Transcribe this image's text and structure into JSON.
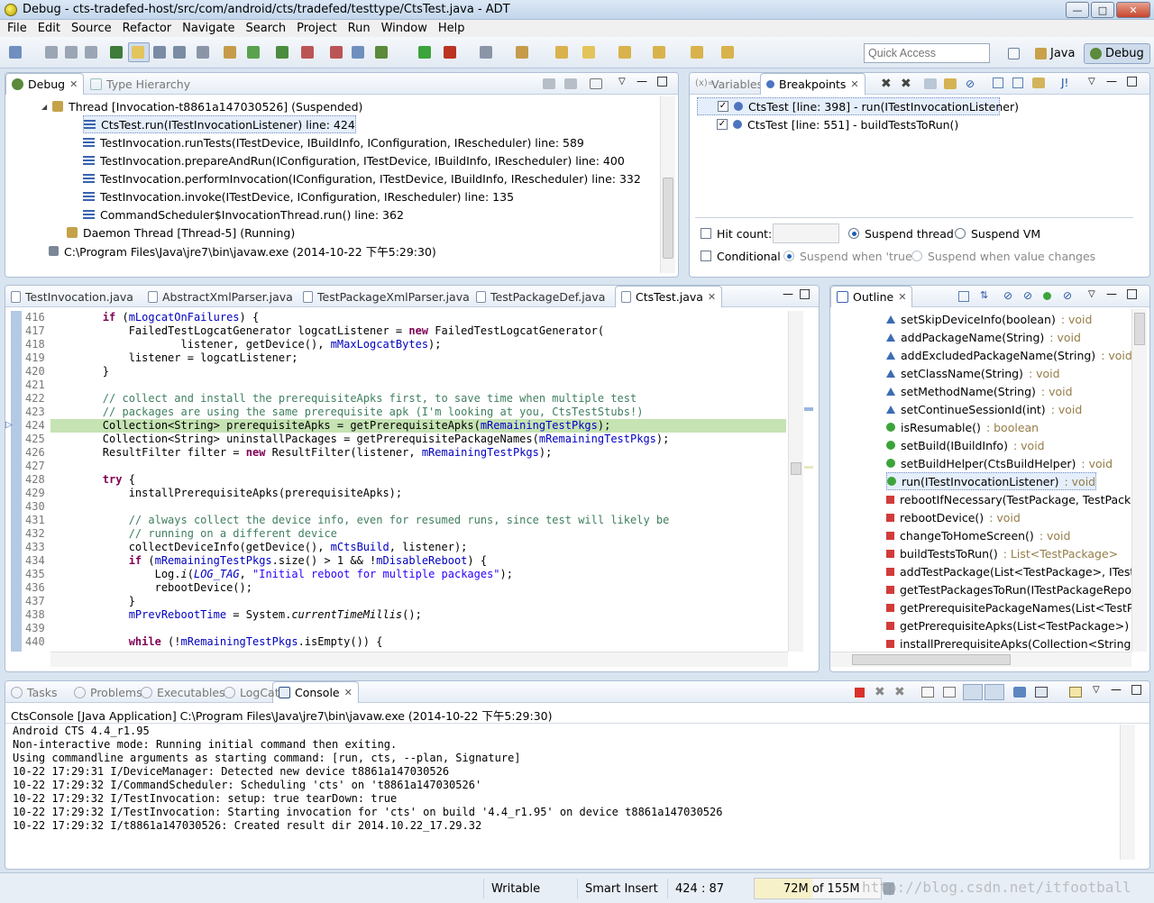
{
  "window": {
    "title": "Debug - cts-tradefed-host/src/com/android/cts/tradefed/testtype/CtsTest.java - ADT"
  },
  "menu": [
    "File",
    "Edit",
    "Source",
    "Refactor",
    "Navigate",
    "Search",
    "Project",
    "Run",
    "Window",
    "Help"
  ],
  "toolbar": {
    "quick_access_placeholder": "Quick Access",
    "perspectives": [
      "Java",
      "Debug"
    ]
  },
  "debug_view": {
    "tabs": [
      "Debug",
      "Type Hierarchy"
    ],
    "rows": [
      {
        "label": "Thread [Invocation-t8861a147030526] (Suspended)",
        "indent": 60,
        "kind": "thread"
      },
      {
        "label": "CtsTest.run(ITestInvocationListener) line: 424",
        "indent": 92,
        "kind": "frame",
        "selected": true
      },
      {
        "label": "TestInvocation.runTests(ITestDevice, IBuildInfo, IConfiguration, IRescheduler) line: 589",
        "indent": 92,
        "kind": "frame"
      },
      {
        "label": "TestInvocation.prepareAndRun(IConfiguration, ITestDevice, IBuildInfo, IRescheduler) line: 400",
        "indent": 92,
        "kind": "frame"
      },
      {
        "label": "TestInvocation.performInvocation(IConfiguration, ITestDevice, IBuildInfo, IRescheduler) line: 332",
        "indent": 92,
        "kind": "frame"
      },
      {
        "label": "TestInvocation.invoke(ITestDevice, IConfiguration, IRescheduler) line: 135",
        "indent": 92,
        "kind": "frame"
      },
      {
        "label": "CommandScheduler$InvocationThread.run() line: 362",
        "indent": 92,
        "kind": "frame"
      },
      {
        "label": "Daemon Thread [Thread-5] (Running)",
        "indent": 74,
        "kind": "thread"
      },
      {
        "label": "C:\\Program Files\\Java\\jre7\\bin\\javaw.exe (2014-10-22 下午5:29:30)",
        "indent": 54,
        "kind": "process"
      }
    ]
  },
  "breakpoints_view": {
    "tabs": [
      "Variables",
      "Breakpoints"
    ],
    "items": [
      "CtsTest [line: 398] - run(ITestInvocationListener)",
      "CtsTest [line: 551] - buildTestsToRun()"
    ],
    "hit_count_label": "Hit count:",
    "suspend_thread": "Suspend thread",
    "suspend_vm": "Suspend VM",
    "conditional_label": "Conditional",
    "suspend_true": "Suspend when 'true'",
    "suspend_changes": "Suspend when value changes"
  },
  "editor": {
    "tabs": [
      "TestInvocation.java",
      "AbstractXmlParser.java",
      "TestPackageXmlParser.java",
      "TestPackageDef.java",
      "CtsTest.java"
    ],
    "lines": [
      {
        "n": "416",
        "h": "        <span class=\"kw\">if</span> (<span class=\"fd\">mLogcatOnFailures</span>) {"
      },
      {
        "n": "417",
        "h": "            FailedTestLogcatGenerator logcatListener = <span class=\"kw\">new</span> FailedTestLogcatGenerator("
      },
      {
        "n": "418",
        "h": "                    listener, getDevice(), <span class=\"fd\">mMaxLogcatBytes</span>);"
      },
      {
        "n": "419",
        "h": "            listener = logcatListener;"
      },
      {
        "n": "420",
        "h": "        }"
      },
      {
        "n": "421",
        "h": ""
      },
      {
        "n": "422",
        "h": "        <span class=\"cm\">// collect and install the prerequisiteApks first, to save time when multiple test</span>"
      },
      {
        "n": "423",
        "h": "        <span class=\"cm\">// packages are using the same prerequisite apk (I'm looking at you, CtsTestStubs!)</span>"
      },
      {
        "n": "424",
        "h": "        Collection&lt;String&gt; prerequisiteApks = getPrerequisiteApks(<span class=\"fd\">mRemainingTestPkgs</span>);",
        "current": true
      },
      {
        "n": "425",
        "h": "        Collection&lt;String&gt; uninstallPackages = getPrerequisitePackageNames(<span class=\"fd\">mRemainingTestPkgs</span>);"
      },
      {
        "n": "426",
        "h": "        ResultFilter filter = <span class=\"kw\">new</span> ResultFilter(listener, <span class=\"fd\">mRemainingTestPkgs</span>);"
      },
      {
        "n": "427",
        "h": ""
      },
      {
        "n": "428",
        "h": "        <span class=\"kw\">try</span> {"
      },
      {
        "n": "429",
        "h": "            installPrerequisiteApks(prerequisiteApks);"
      },
      {
        "n": "430",
        "h": ""
      },
      {
        "n": "431",
        "h": "            <span class=\"cm\">// always collect the device info, even for resumed runs, since test will likely be</span>"
      },
      {
        "n": "432",
        "h": "            <span class=\"cm\">// running on a different device</span>"
      },
      {
        "n": "433",
        "h": "            collectDeviceInfo(getDevice(), <span class=\"fd\">mCtsBuild</span>, listener);"
      },
      {
        "n": "434",
        "h": "            <span class=\"kw\">if</span> (<span class=\"fd\">mRemainingTestPkgs</span>.size() &gt; 1 &amp;&amp; !<span class=\"fd\">mDisableReboot</span>) {"
      },
      {
        "n": "435",
        "h": "                Log.<span class=\"it\">i</span>(<span class=\"fd it\">LOG_TAG</span>, <span class=\"st\">\"Initial reboot for multiple packages\"</span>);"
      },
      {
        "n": "436",
        "h": "                rebootDevice();"
      },
      {
        "n": "437",
        "h": "            }"
      },
      {
        "n": "438",
        "h": "            <span class=\"fd\">mPrevRebootTime</span> = System.<span class=\"it\">currentTimeMillis</span>();"
      },
      {
        "n": "439",
        "h": ""
      },
      {
        "n": "440",
        "h": "            <span class=\"kw\">while</span> (!<span class=\"fd\">mRemainingTestPkgs</span>.isEmpty()) {"
      }
    ]
  },
  "outline": {
    "tab": "Outline",
    "items": [
      {
        "name": "setSkipDeviceInfo(boolean)",
        "ret": " : void",
        "icon": "tri"
      },
      {
        "name": "addPackageName(String)",
        "ret": " : void",
        "icon": "tri"
      },
      {
        "name": "addExcludedPackageName(String)",
        "ret": " : void",
        "icon": "tri"
      },
      {
        "name": "setClassName(String)",
        "ret": " : void",
        "icon": "tri"
      },
      {
        "name": "setMethodName(String)",
        "ret": " : void",
        "icon": "tri"
      },
      {
        "name": "setContinueSessionId(int)",
        "ret": " : void",
        "icon": "tri"
      },
      {
        "name": "isResumable()",
        "ret": " : boolean",
        "icon": "circ"
      },
      {
        "name": "setBuild(IBuildInfo)",
        "ret": " : void",
        "icon": "circ"
      },
      {
        "name": "setBuildHelper(CtsBuildHelper)",
        "ret": " : void",
        "icon": "circ"
      },
      {
        "name": "run(ITestInvocationListener)",
        "ret": " : void",
        "icon": "circ",
        "selected": true
      },
      {
        "name": "rebootIfNecessary(TestPackage, TestPack",
        "ret": "",
        "icon": "sq"
      },
      {
        "name": "rebootDevice()",
        "ret": " : void",
        "icon": "sq"
      },
      {
        "name": "changeToHomeScreen()",
        "ret": " : void",
        "icon": "sq"
      },
      {
        "name": "buildTestsToRun()",
        "ret": " : List<TestPackage>",
        "icon": "sq"
      },
      {
        "name": "addTestPackage(List<TestPackage>, ITest",
        "ret": "",
        "icon": "sq"
      },
      {
        "name": "getTestPackagesToRun(ITestPackageRepo",
        "ret": "",
        "icon": "sq"
      },
      {
        "name": "getPrerequisitePackageNames(List<TestPa",
        "ret": "",
        "icon": "sq"
      },
      {
        "name": "getPrerequisiteApks(List<TestPackage>) :",
        "ret": "",
        "icon": "sq"
      },
      {
        "name": "installPrerequisiteApks(Collection<String>",
        "ret": "",
        "icon": "sq"
      }
    ]
  },
  "console": {
    "tabs": [
      "Tasks",
      "Problems",
      "Executables",
      "LogCat",
      "Console"
    ],
    "header": "CtsConsole [Java Application] C:\\Program Files\\Java\\jre7\\bin\\javaw.exe (2014-10-22 下午5:29:30)",
    "lines": [
      "Android CTS 4.4_r1.95",
      "Non-interactive mode: Running initial command then exiting.",
      "Using commandline arguments as starting command: [run, cts, --plan, Signature]",
      "10-22 17:29:31 I/DeviceManager: Detected new device t8861a147030526",
      "10-22 17:29:32 I/CommandScheduler: Scheduling 'cts' on 't8861a147030526'",
      "10-22 17:29:32 I/TestInvocation: setup: true tearDown: true",
      "10-22 17:29:32 I/TestInvocation: Starting invocation for 'cts' on build '4.4_r1.95' on device t8861a147030526",
      "10-22 17:29:32 I/t8861a147030526: Created result dir 2014.10.22_17.29.32"
    ]
  },
  "status": {
    "writable": "Writable",
    "insert": "Smart Insert",
    "position": "424 : 87",
    "memory": "72M of 155M",
    "watermark": "http://blog.csdn.net/itfootball"
  },
  "colors": {
    "current_line": "#c6e3b4",
    "keyword": "#7f0055",
    "comment": "#3f7f5f",
    "string": "#2a00ff",
    "field": "#0000c0",
    "panel_border": "#aebfd4"
  }
}
